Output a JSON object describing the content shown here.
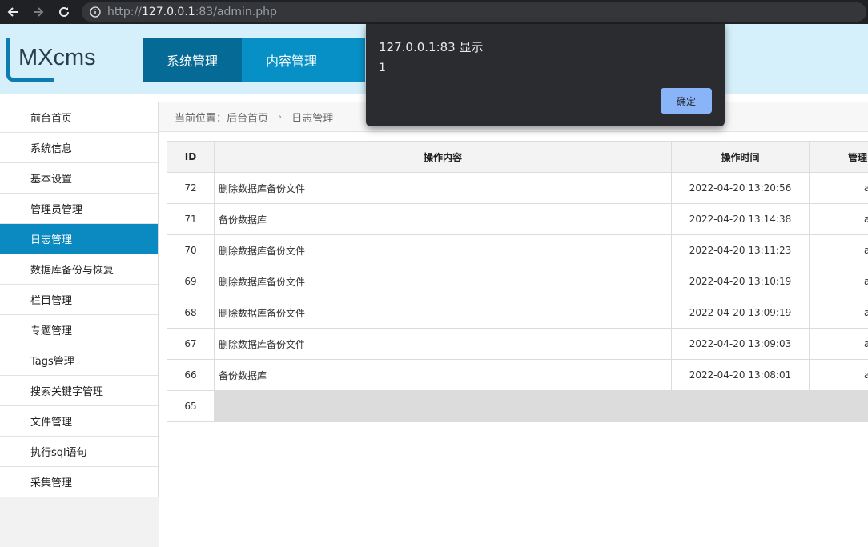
{
  "browser": {
    "url_scheme": "http://",
    "url_host": "127.0.0.1",
    "url_rest": ":83/admin.php"
  },
  "header": {
    "logo_text": "MXcms",
    "nav": [
      {
        "label": "系统管理"
      },
      {
        "label": "内容管理"
      }
    ]
  },
  "sidebar": {
    "items": [
      {
        "label": "前台首页"
      },
      {
        "label": "系统信息"
      },
      {
        "label": "基本设置"
      },
      {
        "label": "管理员管理"
      },
      {
        "label": "日志管理"
      },
      {
        "label": "数据库备份与恢复"
      },
      {
        "label": "栏目管理"
      },
      {
        "label": "专题管理"
      },
      {
        "label": "Tags管理"
      },
      {
        "label": "搜索关键字管理"
      },
      {
        "label": "文件管理"
      },
      {
        "label": "执行sql语句"
      },
      {
        "label": "采集管理"
      }
    ]
  },
  "breadcrumb": {
    "prefix": "当前位置：",
    "home": "后台首页",
    "sep": "›",
    "current": "日志管理"
  },
  "table": {
    "headers": [
      "ID",
      "操作内容",
      "操作时间",
      "管理"
    ],
    "rows": [
      {
        "id": "72",
        "content": "删除数据库备份文件",
        "time": "2022-04-20 13:20:56",
        "admin": "a"
      },
      {
        "id": "71",
        "content": "备份数据库",
        "time": "2022-04-20 13:14:38",
        "admin": "a"
      },
      {
        "id": "70",
        "content": "删除数据库备份文件",
        "time": "2022-04-20 13:11:23",
        "admin": "a"
      },
      {
        "id": "69",
        "content": "删除数据库备份文件",
        "time": "2022-04-20 13:10:19",
        "admin": "a"
      },
      {
        "id": "68",
        "content": "删除数据库备份文件",
        "time": "2022-04-20 13:09:19",
        "admin": "a"
      },
      {
        "id": "67",
        "content": "删除数据库备份文件",
        "time": "2022-04-20 13:09:03",
        "admin": "a"
      },
      {
        "id": "66",
        "content": "备份数据库",
        "time": "2022-04-20 13:08:01",
        "admin": "a"
      },
      {
        "id": "65",
        "content": "",
        "time": "",
        "admin": ""
      }
    ]
  },
  "dialog": {
    "title": "127.0.0.1:83 显示",
    "message": "1",
    "ok_label": "确定"
  },
  "colors": {
    "header_bg": "#d6f0fb",
    "nav_active": "#056a96",
    "nav_item": "#0790c6",
    "sidebar_active": "#0a8ac0",
    "dialog_button": "#8ab4f8"
  }
}
